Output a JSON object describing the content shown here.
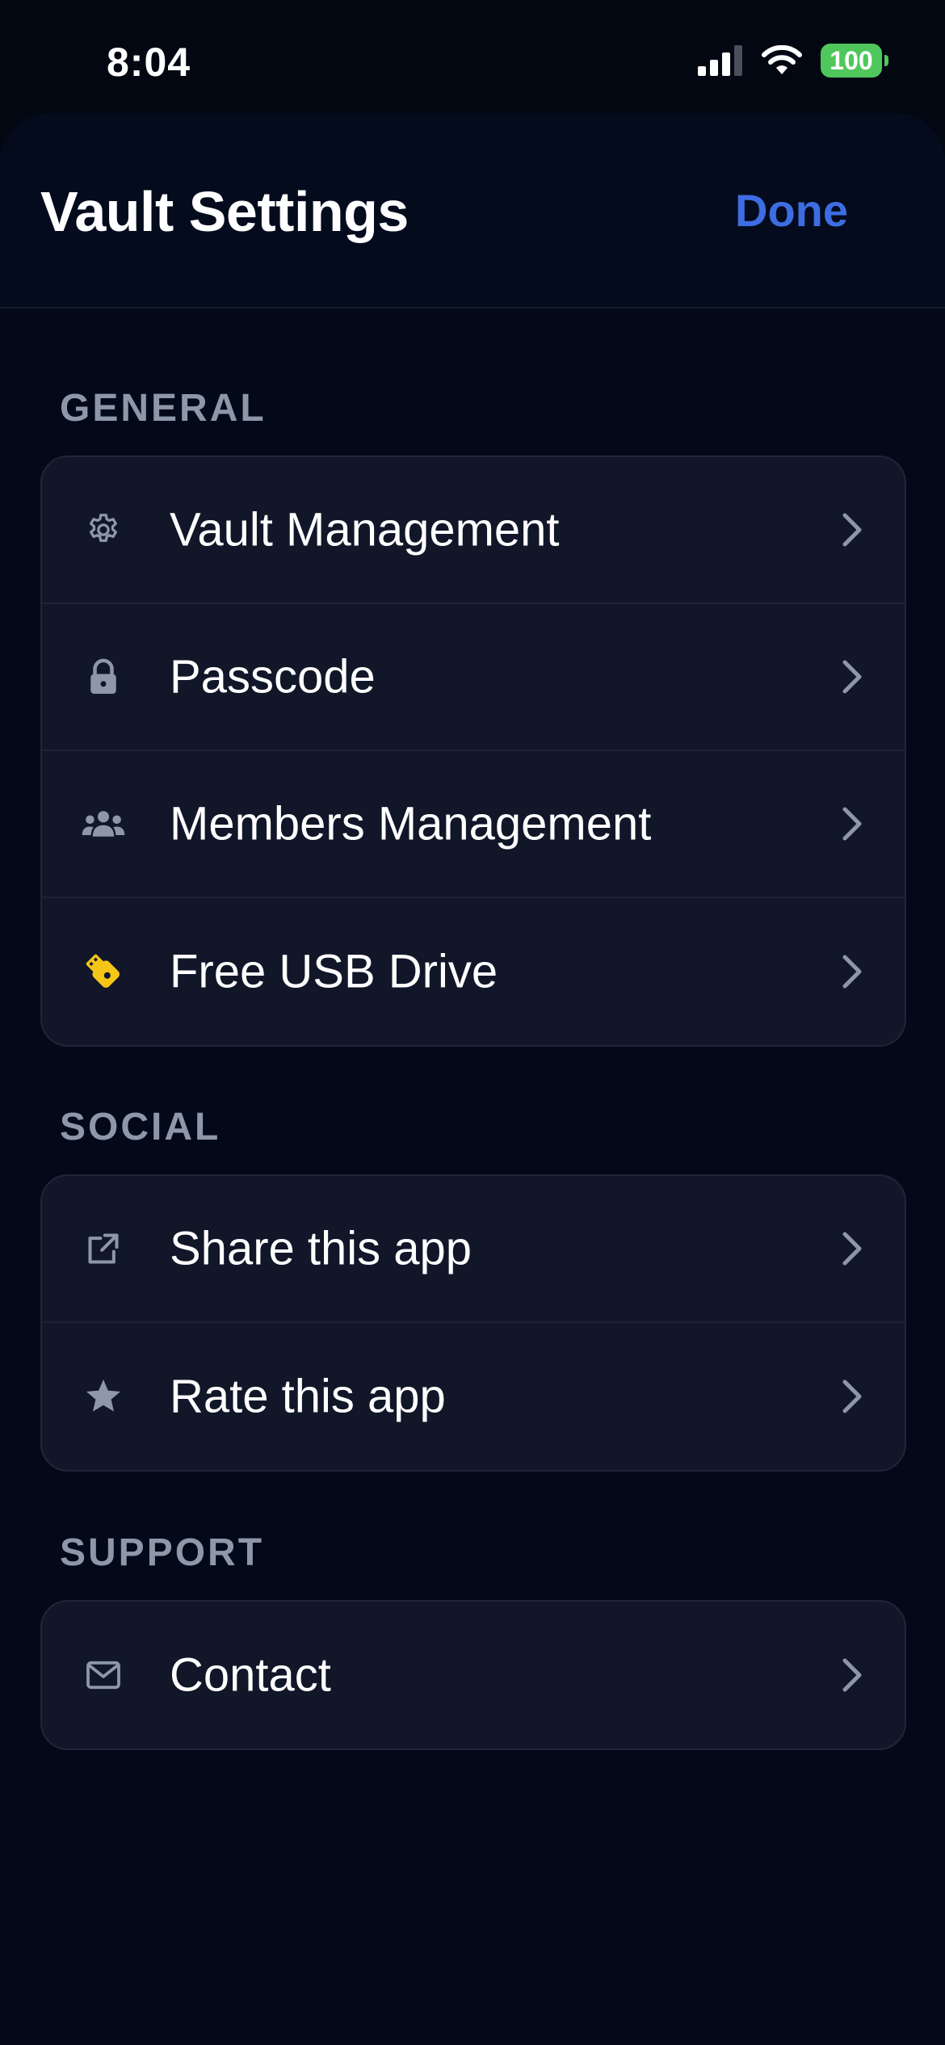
{
  "status_bar": {
    "time": "8:04",
    "battery_level": "100",
    "icons": [
      "signal-icon",
      "wifi-icon",
      "battery-icon"
    ]
  },
  "header": {
    "title": "Vault Settings",
    "done_label": "Done"
  },
  "sections": {
    "general": {
      "label": "GENERAL",
      "items": [
        {
          "label": "Vault Management",
          "icon": "gear-icon"
        },
        {
          "label": "Passcode",
          "icon": "lock-icon"
        },
        {
          "label": "Members Management",
          "icon": "people-icon"
        },
        {
          "label": "Free USB Drive",
          "icon": "usb-drive-icon"
        }
      ]
    },
    "social": {
      "label": "SOCIAL",
      "items": [
        {
          "label": "Share this app",
          "icon": "share-external-icon"
        },
        {
          "label": "Rate this app",
          "icon": "star-icon"
        }
      ]
    },
    "support": {
      "label": "SUPPORT",
      "items": [
        {
          "label": "Contact",
          "icon": "envelope-icon"
        }
      ]
    }
  },
  "colors": {
    "background": "#030712",
    "card": "#111729",
    "accent": "#3d6de1",
    "section_label": "#8e97aa",
    "icon_muted": "#8e97aa",
    "usb_icon": "#f5c518",
    "battery": "#4fc75d"
  }
}
